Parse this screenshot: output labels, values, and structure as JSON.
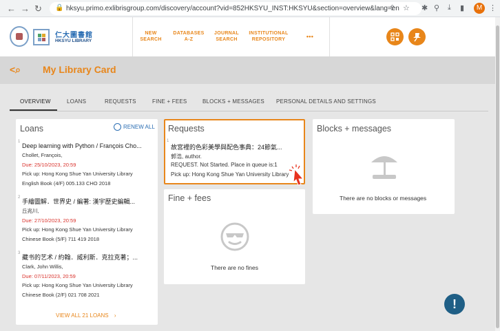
{
  "browser": {
    "url": "hksyu.primo.exlibrisgroup.com/discovery/account?vid=852HKSYU_INST:HKSYU&section=overview&lang=en",
    "avatar_letter": "M"
  },
  "header": {
    "logo_zh": "仁大圖書館",
    "logo_en": "HKSYU LIBRARY",
    "nav": [
      {
        "line1": "NEW",
        "line2": "SEARCH"
      },
      {
        "line1": "DATABASES",
        "line2": "A-Z"
      },
      {
        "line1": "JOURNAL",
        "line2": "SEARCH"
      },
      {
        "line1": "INSTITUTIONAL",
        "line2": "REPOSITORY"
      }
    ],
    "more": "•••"
  },
  "page": {
    "title": "My Library Card"
  },
  "tabs": [
    "OVERVIEW",
    "LOANS",
    "REQUESTS",
    "FINE + FEES",
    "BLOCKS + MESSAGES",
    "PERSONAL DETAILS AND SETTINGS"
  ],
  "loans": {
    "title": "Loans",
    "renew_all": "RENEW ALL",
    "view_all": "VIEW ALL 21 LOANS",
    "items": [
      {
        "num": "1",
        "title": "Deep learning with Python / François Cho...",
        "author": "Chollet, François,",
        "due": "Due: 25/10/2023, 20:59",
        "pickup": "Pick up: Hong Kong Shue Yan University Library",
        "location": "English Book (4/F) 005.133 CHO 2018"
      },
      {
        "num": "2",
        "title": "手繪圖解．世界史 / 編著: 漢宇歷史編輯...",
        "author": "丘兆川,",
        "due": "Due: 27/10/2023, 20:59",
        "pickup": "Pick up: Hong Kong Shue Yan University Library",
        "location": "Chinese Book (5/F) 711 419 2018"
      },
      {
        "num": "3",
        "title": "藏书的艺术 / 約翰．威利斯．克拉克著；...",
        "author": "Clark, John Willis,",
        "due": "Due: 07/11/2023, 20:59",
        "pickup": "Pick up: Hong Kong Shue Yan University Library",
        "location": "Chinese Book (2/F) 021 708 2021"
      }
    ]
  },
  "requests": {
    "title": "Requests",
    "num": "1",
    "item_title": "故宮裡的色彩美學與配色事典：24節氣...",
    "author": "郭浩, author.",
    "status": "REQUEST. Not Started. Place in queue is:1",
    "pickup": "Pick up: Hong Kong Shue Yan University Library"
  },
  "fines": {
    "title": "Fine + fees",
    "empty": "There are no fines"
  },
  "blocks": {
    "title": "Blocks + messages",
    "empty": "There are no blocks or messages"
  },
  "colors": {
    "accent": "#e8861a",
    "due_red": "#d9302a",
    "link_blue": "#2a6db3"
  }
}
